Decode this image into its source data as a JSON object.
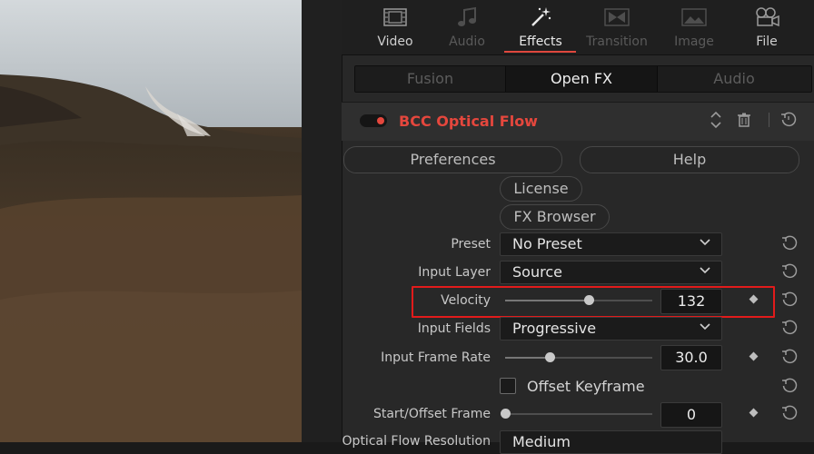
{
  "top_tabs": [
    {
      "label": "Video",
      "icon": "video-filmstrip-icon",
      "state": "normal"
    },
    {
      "label": "Audio",
      "icon": "music-note-icon",
      "state": "dim"
    },
    {
      "label": "Effects",
      "icon": "magic-wand-icon",
      "state": "active"
    },
    {
      "label": "Transition",
      "icon": "transition-icon",
      "state": "dim"
    },
    {
      "label": "Image",
      "icon": "image-icon",
      "state": "dim"
    },
    {
      "label": "File",
      "icon": "file-reels-icon",
      "state": "normal"
    }
  ],
  "sub_tabs": [
    {
      "label": "Fusion",
      "active": false
    },
    {
      "label": "Open FX",
      "active": true
    },
    {
      "label": "Audio",
      "active": false
    }
  ],
  "effect": {
    "name": "BCC Optical Flow",
    "enabled": true,
    "accent_color": "#e5473d"
  },
  "buttons": {
    "preferences": "Preferences",
    "help": "Help",
    "license": "License",
    "fx_browser": "FX Browser"
  },
  "properties": {
    "preset": {
      "label": "Preset",
      "value": "No Preset"
    },
    "input_layer": {
      "label": "Input Layer",
      "value": "Source"
    },
    "velocity": {
      "label": "Velocity",
      "value": "132",
      "slider_fraction": 0.57
    },
    "input_fields": {
      "label": "Input Fields",
      "value": "Progressive"
    },
    "input_frame_rate": {
      "label": "Input Frame Rate",
      "value": "30.0",
      "slider_fraction": 0.3
    },
    "offset_keyframe": {
      "label": "Offset Keyframe",
      "checked": false
    },
    "start_offset_frame": {
      "label": "Start/Offset Frame",
      "value": "0",
      "slider_fraction": 0.0
    },
    "optical_flow_resolution": {
      "label": "Optical Flow Resolution",
      "value": "Medium"
    }
  },
  "highlight_color": "#e21b1b"
}
